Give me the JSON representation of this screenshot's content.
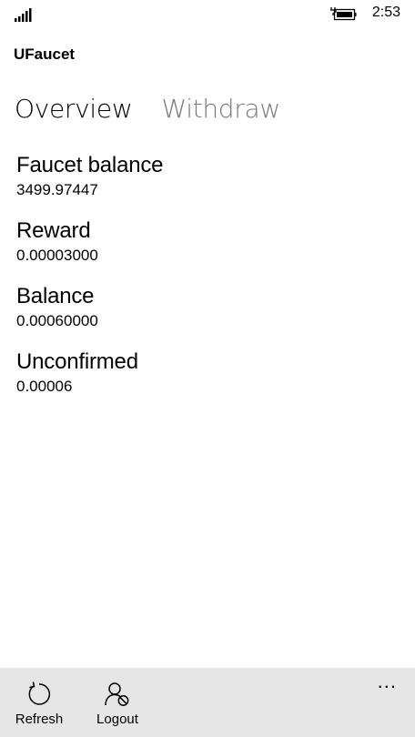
{
  "status_bar": {
    "time": "2:53",
    "signal_icon": "signal-icon",
    "battery_icon": "battery-charging-icon"
  },
  "app": {
    "title": "UFaucet"
  },
  "pivot": {
    "tabs": [
      {
        "label": "Overview",
        "active": true
      },
      {
        "label": "Withdraw",
        "active": false
      }
    ]
  },
  "overview": {
    "fields": [
      {
        "label": "Faucet balance",
        "value": "3499.97447"
      },
      {
        "label": "Reward",
        "value": "0.00003000"
      },
      {
        "label": "Balance",
        "value": "0.00060000"
      },
      {
        "label": "Unconfirmed",
        "value": "0.00006"
      }
    ]
  },
  "app_bar": {
    "background": "#e6e6e6",
    "buttons": [
      {
        "label": "Refresh",
        "icon": "refresh-icon"
      },
      {
        "label": "Logout",
        "icon": "logout-icon"
      }
    ],
    "more_label": "..."
  }
}
